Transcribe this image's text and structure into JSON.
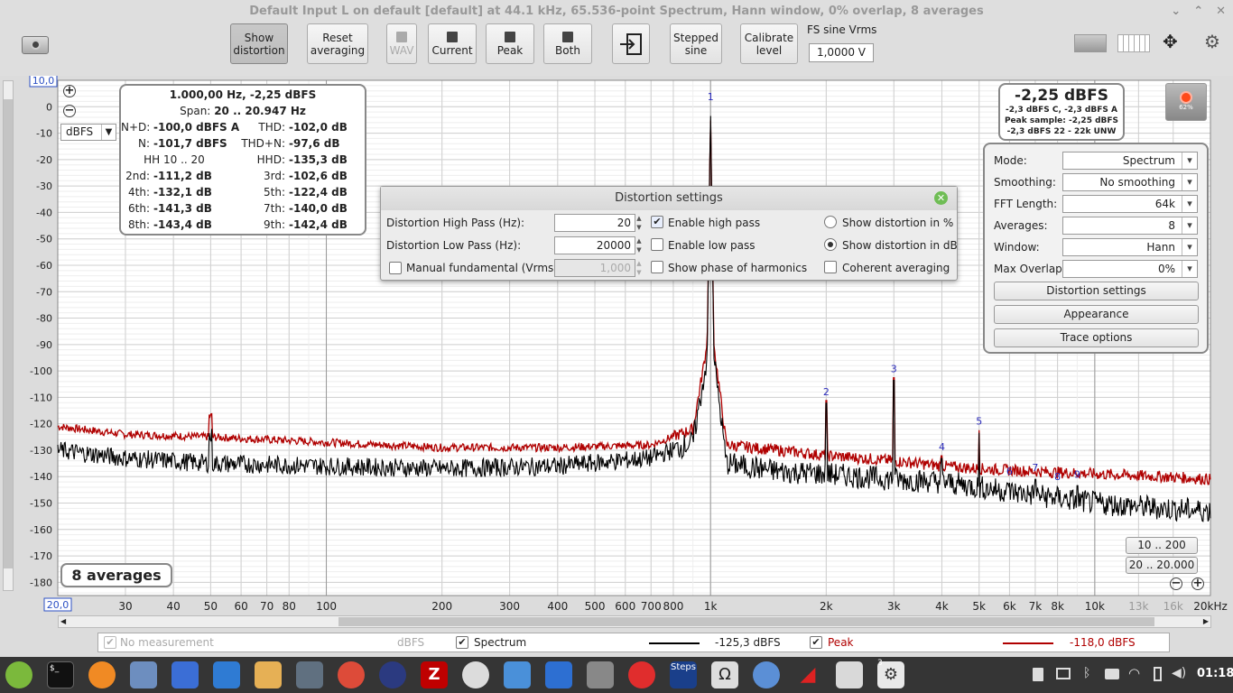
{
  "window": {
    "title": "Default Input L on default [default] at 44.1 kHz, 65.536-point Spectrum, Hann window, 0% overlap, 8 averages"
  },
  "toolbar": {
    "show_distortion": [
      "Show",
      "distortion"
    ],
    "reset_averaging": [
      "Reset",
      "averaging"
    ],
    "wav": "WAV",
    "current": "Current",
    "peak": "Peak",
    "both": "Both",
    "stepped_sine": [
      "Stepped",
      "sine"
    ],
    "calibrate_level": [
      "Calibrate",
      "level"
    ],
    "fs_label": "FS sine Vrms",
    "fs_value": "1,0000 V"
  },
  "chart": {
    "y_unit": "dBFS",
    "y_top": "10,0",
    "y_ticks": [
      "0",
      "-10",
      "-20",
      "-30",
      "-40",
      "-50",
      "-60",
      "-70",
      "-80",
      "-90",
      "-100",
      "-110",
      "-120",
      "-130",
      "-140",
      "-150",
      "-160",
      "-170",
      "-180"
    ],
    "x_start": "20,0",
    "x_ticks": [
      {
        "f": 30,
        "label": "30"
      },
      {
        "f": 40,
        "label": "40"
      },
      {
        "f": 50,
        "label": "50"
      },
      {
        "f": 60,
        "label": "60"
      },
      {
        "f": 70,
        "label": "70"
      },
      {
        "f": 80,
        "label": "80"
      },
      {
        "f": 100,
        "label": "100"
      },
      {
        "f": 200,
        "label": "200"
      },
      {
        "f": 300,
        "label": "300"
      },
      {
        "f": 400,
        "label": "400"
      },
      {
        "f": 500,
        "label": "500"
      },
      {
        "f": 600,
        "label": "600"
      },
      {
        "f": 700,
        "label": "700"
      },
      {
        "f": 800,
        "label": "800"
      },
      {
        "f": 1000,
        "label": "1k"
      },
      {
        "f": 2000,
        "label": "2k"
      },
      {
        "f": 3000,
        "label": "3k"
      },
      {
        "f": 4000,
        "label": "4k"
      },
      {
        "f": 5000,
        "label": "5k"
      },
      {
        "f": 6000,
        "label": "6k"
      },
      {
        "f": 7000,
        "label": "7k"
      },
      {
        "f": 8000,
        "label": "8k"
      },
      {
        "f": 10000,
        "label": "10k"
      },
      {
        "f": 13000,
        "label": "13k"
      },
      {
        "f": 16000,
        "label": "16k"
      },
      {
        "f": 20000,
        "label": "20kHz"
      }
    ],
    "unit_select": "dBFS",
    "averages_badge": "8 averages",
    "range_btn_1": "10 .. 200",
    "range_btn_2": "20 .. 20.000"
  },
  "chart_data": {
    "type": "line",
    "x_scale": "log",
    "xlim": [
      20,
      20000
    ],
    "ylim": [
      -185,
      10
    ],
    "ylabel": "dBFS",
    "series": [
      {
        "name": "Spectrum",
        "color": "#000000",
        "x": [
          20,
          30,
          50,
          100,
          200,
          400,
          700,
          900,
          980,
          1000,
          1020,
          1100,
          1500,
          2000,
          3000,
          4000,
          5000,
          7000,
          10000,
          15000,
          20000
        ],
        "y": [
          -130,
          -133,
          -135,
          -136,
          -137,
          -136,
          -133,
          -127,
          -95,
          0,
          -95,
          -135,
          -138,
          -139,
          -141,
          -142,
          -144,
          -147,
          -150,
          -152,
          -153
        ]
      },
      {
        "name": "Peak",
        "color": "#b00000",
        "x": [
          20,
          30,
          50,
          100,
          200,
          400,
          700,
          900,
          980,
          1000,
          1020,
          1100,
          1500,
          2000,
          3000,
          4000,
          5000,
          7000,
          10000,
          15000,
          20000
        ],
        "y": [
          -121,
          -124,
          -125,
          -127,
          -129,
          -129,
          -128,
          -122,
          -90,
          -2,
          -90,
          -128,
          -130,
          -132,
          -134,
          -136,
          -137,
          -138,
          -139,
          -140,
          -141
        ]
      }
    ],
    "harmonics": [
      {
        "n": "1",
        "f": 1000,
        "y": -2.25
      },
      {
        "n": "2",
        "f": 2000,
        "y": -111.2
      },
      {
        "n": "3",
        "f": 3000,
        "y": -102.6
      },
      {
        "n": "4",
        "f": 4000,
        "y": -132.1
      },
      {
        "n": "5",
        "f": 5000,
        "y": -122.4
      },
      {
        "n": "6",
        "f": 6000,
        "y": -141.3
      },
      {
        "n": "7",
        "f": 7000,
        "y": -140.0
      },
      {
        "n": "8",
        "f": 8000,
        "y": -143.4
      },
      {
        "n": "9",
        "f": 9000,
        "y": -142.4
      }
    ]
  },
  "readout": {
    "line1": "1.000,00 Hz, -2,25 dBFS",
    "span_label": "Span:",
    "span_value": "20 .. 20.947 Hz",
    "rows": [
      {
        "l1": "N+D:",
        "v1": "-100,0 dBFS A",
        "l2": "THD:",
        "v2": "-102,0 dB"
      },
      {
        "l1": "N:",
        "v1": "-101,7 dBFS",
        "l2": "THD+N:",
        "v2": "-97,6 dB"
      },
      {
        "l1": "HH 10 .. 20",
        "v1": "",
        "l2": "HHD:",
        "v2": "-135,3 dB"
      },
      {
        "l1": "2nd:",
        "v1": "-111,2 dB",
        "l2": "3rd:",
        "v2": "-102,6 dB"
      },
      {
        "l1": "4th:",
        "v1": "-132,1 dB",
        "l2": "5th:",
        "v2": "-122,4 dB"
      },
      {
        "l1": "6th:",
        "v1": "-141,3 dB",
        "l2": "7th:",
        "v2": "-140,0 dB"
      },
      {
        "l1": "8th:",
        "v1": "-143,4 dB",
        "l2": "9th:",
        "v2": "-142,4 dB"
      }
    ]
  },
  "level_box": {
    "big": "-2,25 dBFS",
    "l1": "-2,3 dBFS C, -2,3 dBFS A",
    "l2": "Peak sample: -2,25 dBFS",
    "l3": "-2,3 dBFS 22 - 22k UNW",
    "rec_pct": "62%"
  },
  "dialog": {
    "title": "Distortion settings",
    "hp_label": "Distortion High Pass (Hz):",
    "hp_value": "20",
    "lp_label": "Distortion Low Pass (Hz):",
    "lp_value": "20000",
    "manual_label": "Manual fundamental (Vrms)",
    "manual_value": "1,000",
    "enable_hp": "Enable high pass",
    "enable_lp": "Enable low pass",
    "show_phase": "Show phase of harmonics",
    "show_pct": "Show distortion in %",
    "show_db": "Show distortion in dB",
    "coherent": "Coherent averaging"
  },
  "controls": {
    "mode_label": "Mode:",
    "mode_value": "Spectrum",
    "smoothing_label": "Smoothing:",
    "smoothing_value": "No  smoothing",
    "fft_label": "FFT Length:",
    "fft_value": "64k",
    "avg_label": "Averages:",
    "avg_value": "8",
    "window_label": "Window:",
    "window_value": "Hann",
    "overlap_label": "Max Overlap:",
    "overlap_value": "0%",
    "btn_distortion": "Distortion settings",
    "btn_appearance": "Appearance",
    "btn_trace": "Trace options"
  },
  "legend": {
    "no_measurement": "No measurement",
    "no_meas_unit": "dBFS",
    "spectrum": "Spectrum",
    "spectrum_value": "-125,3 dBFS",
    "peak": "Peak",
    "peak_value": "-118,0 dBFS"
  },
  "taskbar": {
    "clock": "01:18",
    "badge": "3",
    "steps_label": "Steps"
  }
}
